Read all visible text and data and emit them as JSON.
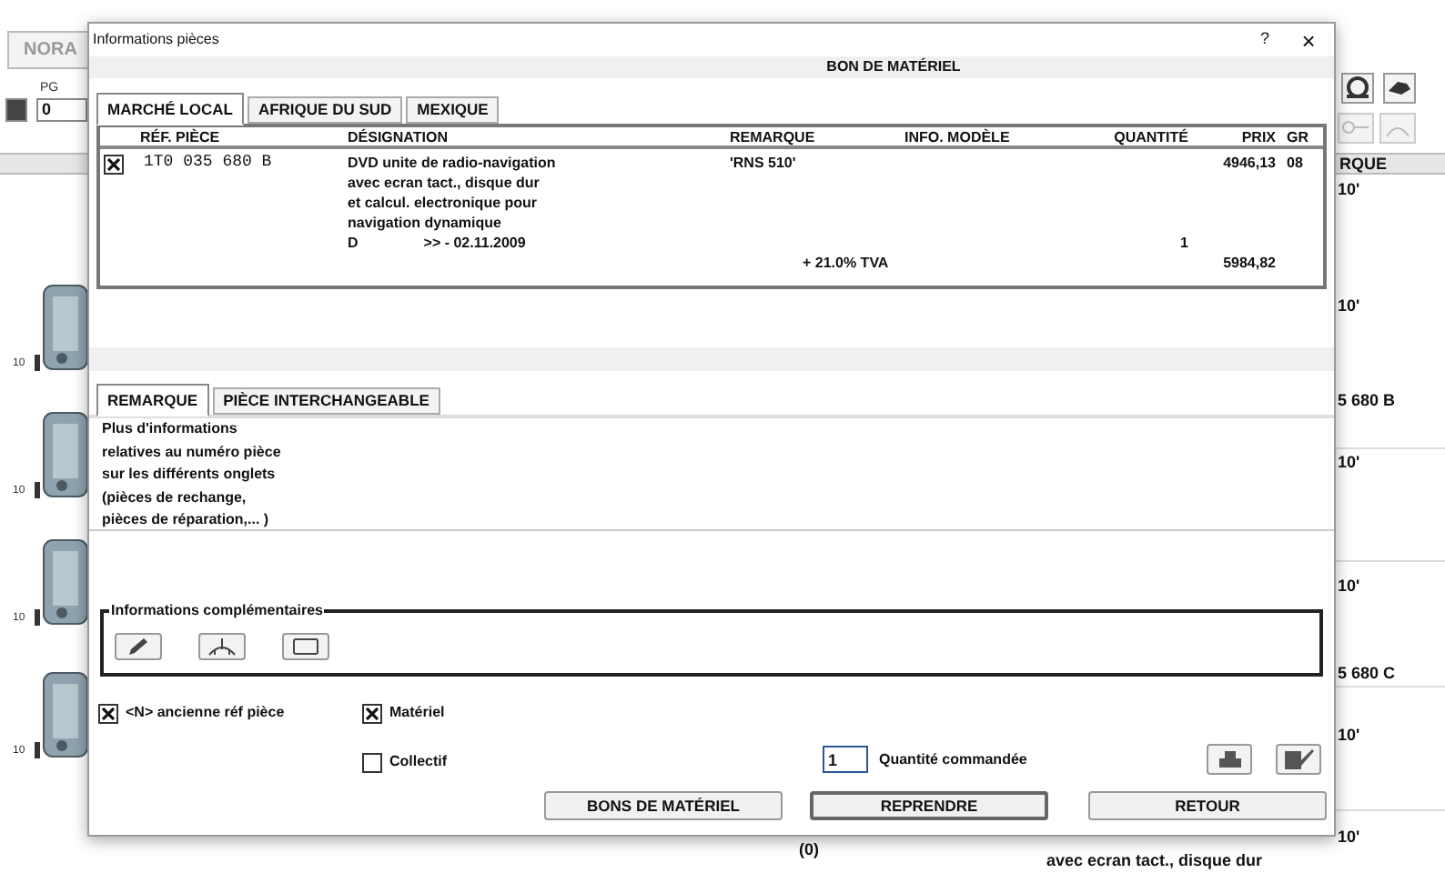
{
  "background_app": {
    "tab": "NORA",
    "pg_label": "PG",
    "pg_value": "0",
    "column_header": "RQUE",
    "cells": [
      "10'",
      "10'",
      "5 680 B",
      "10'",
      "10'",
      "5 680 C",
      "10'",
      "10'"
    ],
    "device_labels": [
      "10",
      "10",
      "10",
      "10"
    ],
    "bottom_index": "(0)",
    "bottom_text": "avec ecran tact., disque dur"
  },
  "window": {
    "title": "Informations pièces",
    "help": "?",
    "close": "×",
    "header": "BON DE MATÉRIEL"
  },
  "market_tabs": [
    {
      "label": "MARCHÉ LOCAL",
      "selected": true
    },
    {
      "label": "AFRIQUE DU SUD",
      "selected": false
    },
    {
      "label": "MEXIQUE",
      "selected": false
    }
  ],
  "table": {
    "columns": [
      "RÉF. PIÈCE",
      "DÉSIGNATION",
      "REMARQUE",
      "INFO. MODÈLE",
      "QUANTITÉ",
      "PRIX",
      "GR"
    ],
    "rows": [
      {
        "checked": true,
        "ref": "1T0 035 680 B",
        "designation": [
          "DVD unite de radio-navigation",
          "avec ecran tact., disque dur",
          "et calcul. electronique pour",
          "navigation dynamique"
        ],
        "remarque": "'RNS 510'",
        "prix": "4946,13",
        "gr": "08",
        "validity_code": "D",
        "validity": ">> - 02.11.2009",
        "quantite": "1"
      }
    ],
    "total": {
      "label": "+ 21.0% TVA",
      "prix": "5984,82"
    }
  },
  "info_tabs": [
    {
      "label": "REMARQUE",
      "selected": true
    },
    {
      "label": "PIÈCE INTERCHANGEABLE",
      "selected": false
    }
  ],
  "remark_text": [
    "Plus d'informations",
    "relatives au numéro pièce",
    "sur les différents onglets",
    "(pièces de rechange,",
    "pièces de réparation,... )"
  ],
  "extra_info": {
    "legend": "Informations complémentaires"
  },
  "options": [
    {
      "label": "<N> ancienne réf pièce",
      "checked": true
    },
    {
      "label": "Matériel",
      "checked": true
    },
    {
      "label": "Collectif",
      "checked": false
    }
  ],
  "quantity": {
    "value": "1",
    "label": "Quantité commandée"
  },
  "buttons": [
    {
      "label": "BONS DE MATÉRIEL",
      "focused": false
    },
    {
      "label": "REPRENDRE",
      "focused": true
    },
    {
      "label": "RETOUR",
      "focused": false
    }
  ]
}
